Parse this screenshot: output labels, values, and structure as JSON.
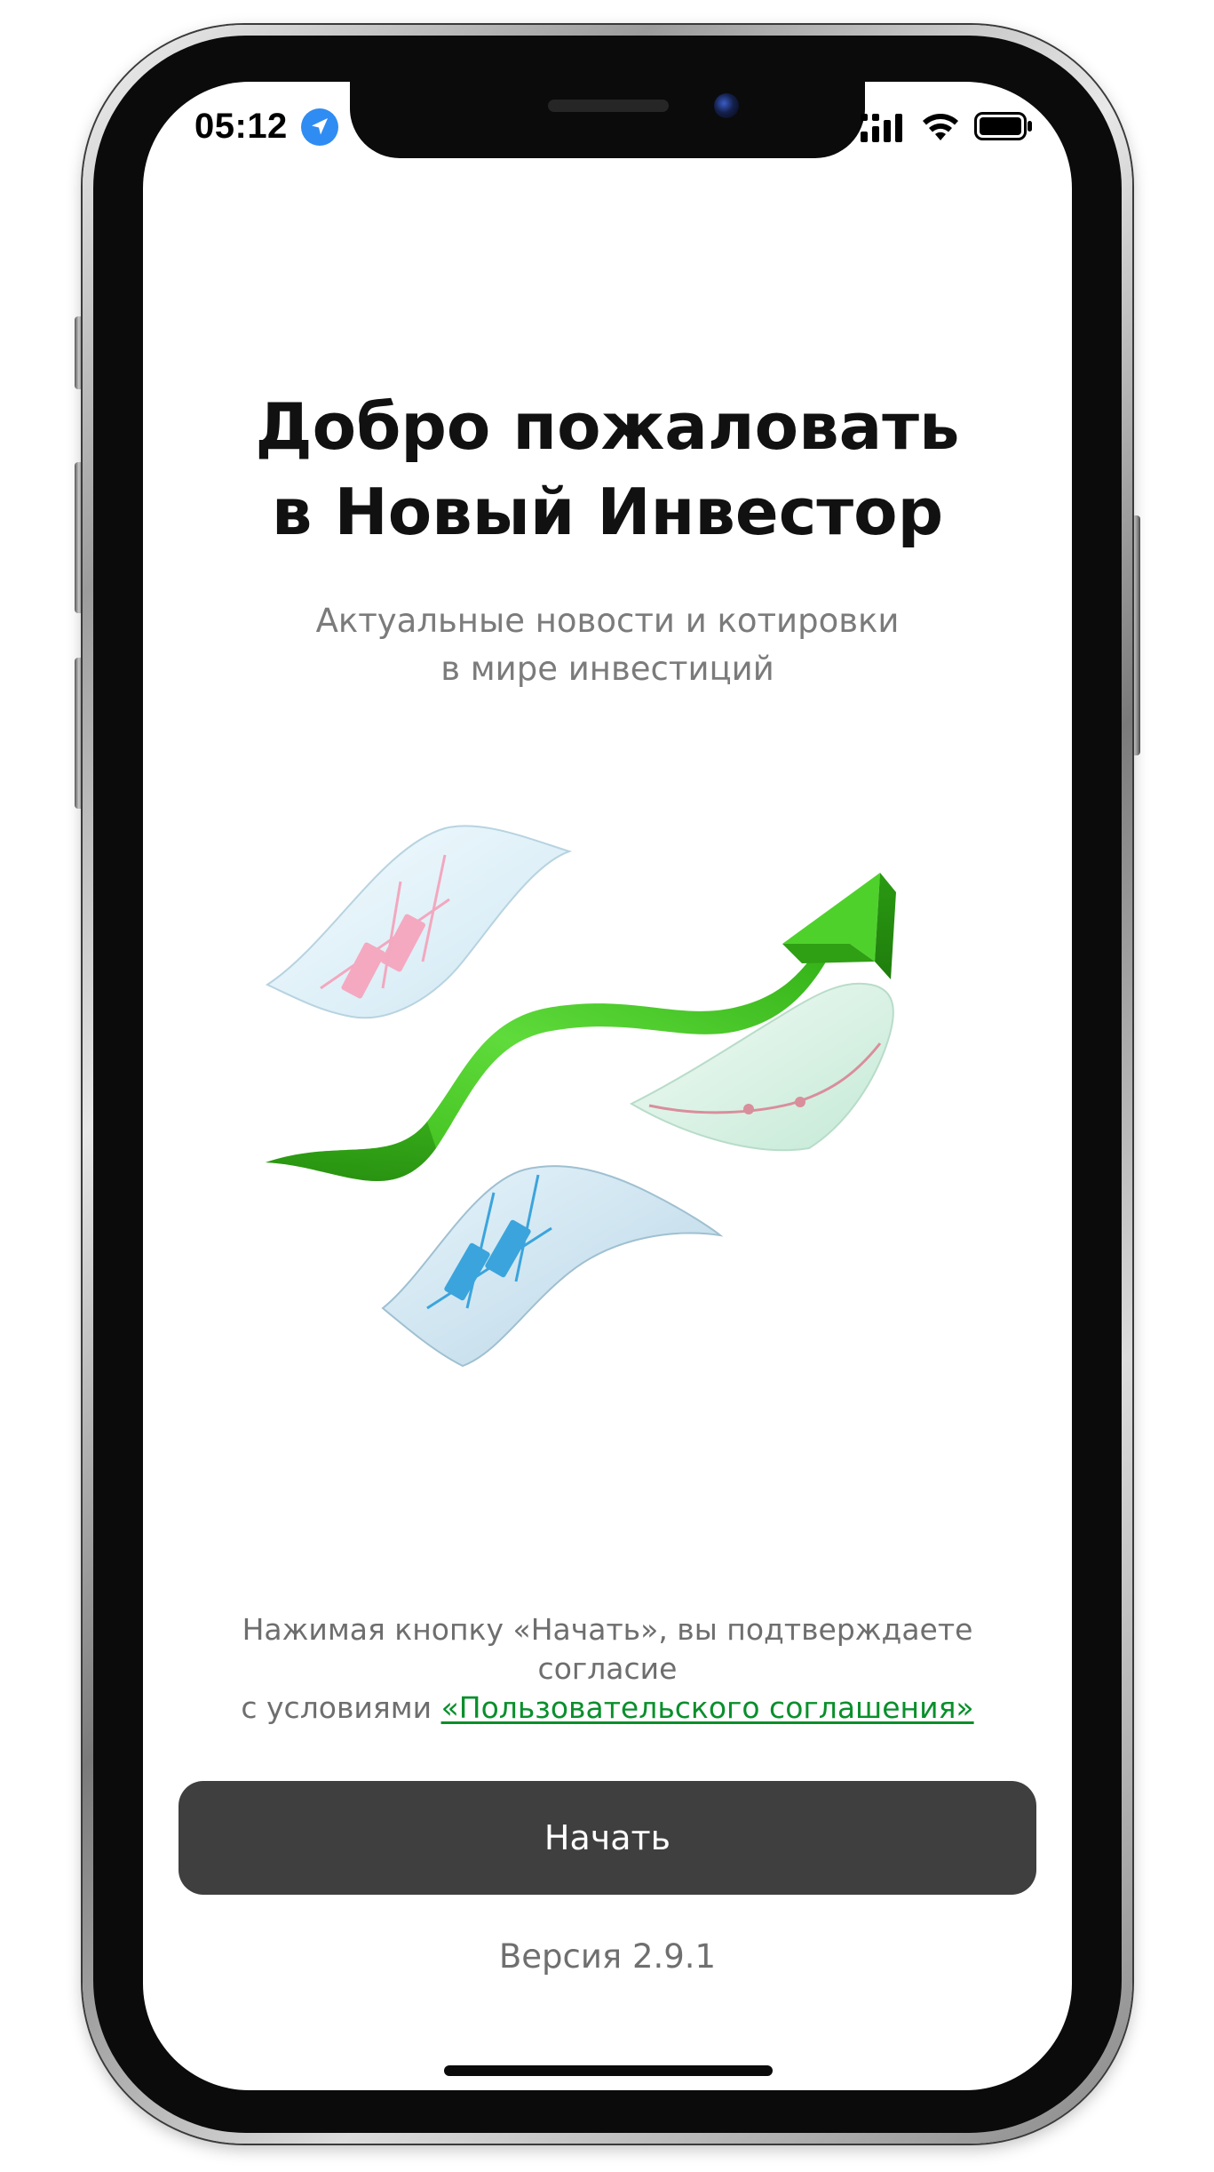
{
  "status_bar": {
    "time": "05:12",
    "icons": [
      "location-arrow-icon",
      "cellular-signal-icon",
      "wifi-icon",
      "battery-icon"
    ]
  },
  "welcome": {
    "title_line1": "Добро пожаловать",
    "title_line2": "в Новый Инвестор",
    "subtitle_line1": "Актуальные новости и котировки",
    "subtitle_line2": "в мире инвестиций"
  },
  "illustration": {
    "icon": "growth-arrow-with-charts-illustration"
  },
  "consent": {
    "line1": "Нажимая кнопку «Начать», вы подтверждаете",
    "line2": "согласие",
    "line3_prefix": "с условиями ",
    "link_text": "«Пользовательского соглашения»"
  },
  "actions": {
    "start_label": "Начать"
  },
  "footer": {
    "version": "Версия 2.9.1"
  },
  "colors": {
    "link": "#0a8f2c",
    "button_bg": "#3f3f3f",
    "button_text": "#ffffff",
    "title": "#111111",
    "muted_text": "#7b7b7b",
    "arrow_green": "#3cc21a",
    "location_blue": "#2f8cf2"
  }
}
